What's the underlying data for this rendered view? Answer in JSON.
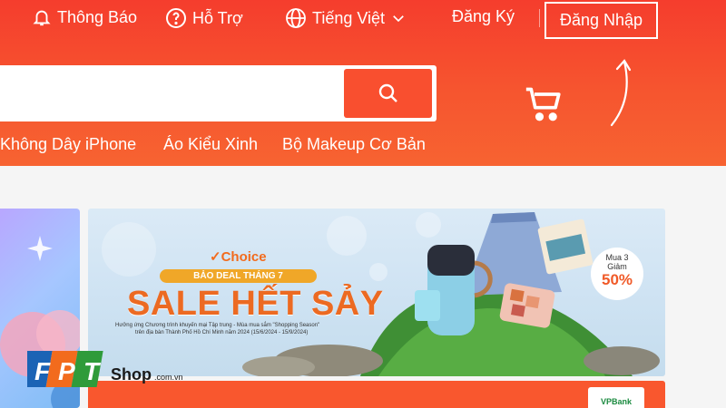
{
  "navbar": {
    "notifications": "Thông Báo",
    "support": "Hỗ Trợ",
    "language": "Tiếng Việt",
    "register": "Đăng Ký",
    "login": "Đăng Nhập"
  },
  "search": {
    "value": "",
    "placeholder": ""
  },
  "suggestions": [
    "Không Dây iPhone",
    "Áo Kiểu Xinh",
    "Bộ Makeup Cơ Bản"
  ],
  "banner": {
    "choice": "Choice",
    "ribbon": "BẢO DEAL THÁNG 7",
    "headline": "SALE HẾT SẢY",
    "fine_print_1": "Hưởng ứng Chương trình khuyến mại Tập trung - Mùa mua sắm \"Shopping Season\"",
    "fine_print_2": "trên địa bàn Thành Phố Hồ Chí Minh năm 2024 (15/6/2024 - 15/9/2024)",
    "badge_line_1": "Mua 3",
    "badge_line_2": "Giảm",
    "badge_value": "50%"
  },
  "bottom_banner": {
    "partner": "VPBank"
  },
  "watermark": {
    "brand": "FPT",
    "shop": "Shop",
    "domain": ".com.vn"
  },
  "colors": {
    "shopee_orange": "#f53d2d",
    "button_orange": "#f94f2f",
    "green": "#2f9b3a",
    "fpt_blue": "#1b63b5"
  }
}
